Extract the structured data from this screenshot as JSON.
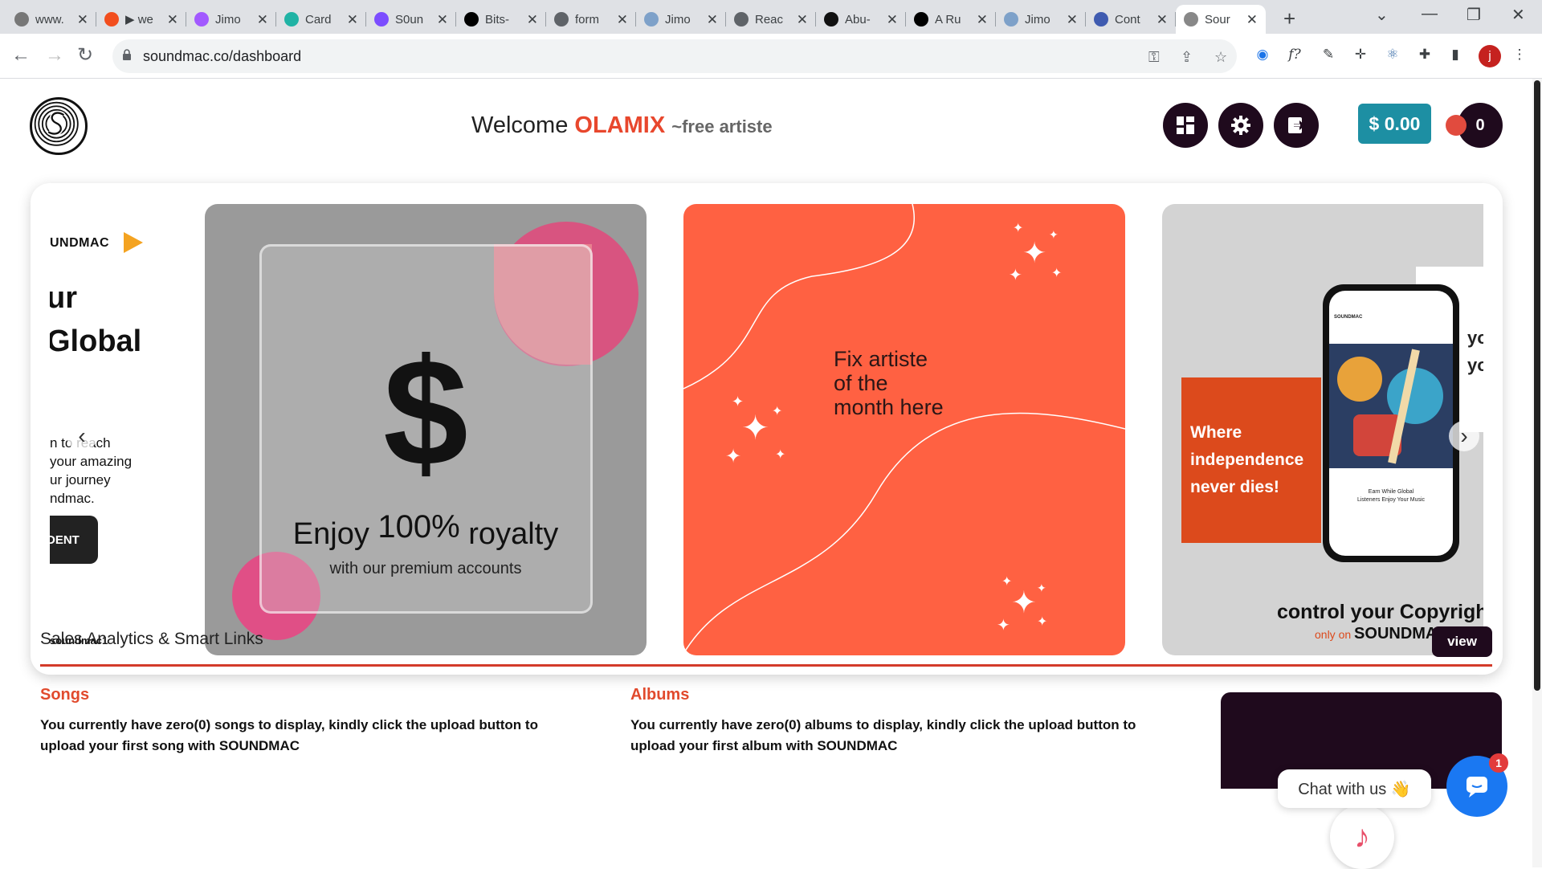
{
  "browser": {
    "tabs": [
      {
        "label": "www.",
        "fav": "#777"
      },
      {
        "label": "▶ we",
        "fav": "#f24e1e"
      },
      {
        "label": "Jimo",
        "fav": "#a259ff"
      },
      {
        "label": "Card",
        "fav": "#20b3a5"
      },
      {
        "label": "S0un",
        "fav": "#7c4dff"
      },
      {
        "label": "Bits-",
        "fav": "#000"
      },
      {
        "label": "form",
        "fav": "#5f6368"
      },
      {
        "label": "Jimo",
        "fav": "#7ea1c9"
      },
      {
        "label": "Reac",
        "fav": "#5f6368"
      },
      {
        "label": "Abu-",
        "fav": "#111"
      },
      {
        "label": "A Ru",
        "fav": "#000"
      },
      {
        "label": "Jimo",
        "fav": "#7ea1c9"
      },
      {
        "label": "Cont",
        "fav": "#3f5bb0"
      },
      {
        "label": "Sour",
        "fav": "#888"
      }
    ],
    "url": "soundmac.co/dashboard",
    "profile_initial": "j"
  },
  "header": {
    "welcome": "Welcome",
    "username": "OLAMIX",
    "role": "~free artiste",
    "balance": "$ 0.00",
    "notifications": "0"
  },
  "carousel": {
    "slide0": {
      "brand": "UNDMAC",
      "heading_line1": "ur",
      "heading_line2": "Global",
      "body_line1": "n to reach",
      "body_line2": "your amazing",
      "body_line3": "ur journey",
      "body_line4": "ndmac.",
      "cta": "DENT",
      "handle": "soundmac1"
    },
    "slide1": {
      "dollar": "$",
      "enjoy_a": "Enjoy",
      "enjoy_pct": "100%",
      "enjoy_b": "royalty",
      "sub": "with our premium accounts"
    },
    "slide2": {
      "line1": "Fix artiste",
      "line2": "of the",
      "line3": "month here"
    },
    "slide3": {
      "orange_line1": "Where",
      "orange_line2": "independence",
      "orange_line3": "never dies!",
      "side_line1": "yo",
      "side_line2": "yo",
      "phone_header": "SOUNDMAC",
      "phone_text1": "Earn While Global",
      "phone_text2": "Listeners Enjoy Your Music",
      "copyright": "control your Copyrigh",
      "only_on": "only on",
      "brand": "SOUNDMAC"
    }
  },
  "analytics": {
    "title": "Sales Analytics & Smart Links",
    "view_label": "view",
    "songs_title": "Songs",
    "songs_text": "You currently have zero(0) songs to display, kindly click the upload button to upload your first song with SOUNDMAC",
    "albums_title": "Albums",
    "albums_text": "You currently have zero(0) albums to display, kindly click the upload button to upload your first album with SOUNDMAC"
  },
  "chat": {
    "label": "Chat with us 👋",
    "badge": "1"
  },
  "colors": {
    "accent_red": "#e14a2d",
    "dark": "#1f0a1d",
    "teal": "#1d8fa3",
    "coral": "#ff6142"
  }
}
